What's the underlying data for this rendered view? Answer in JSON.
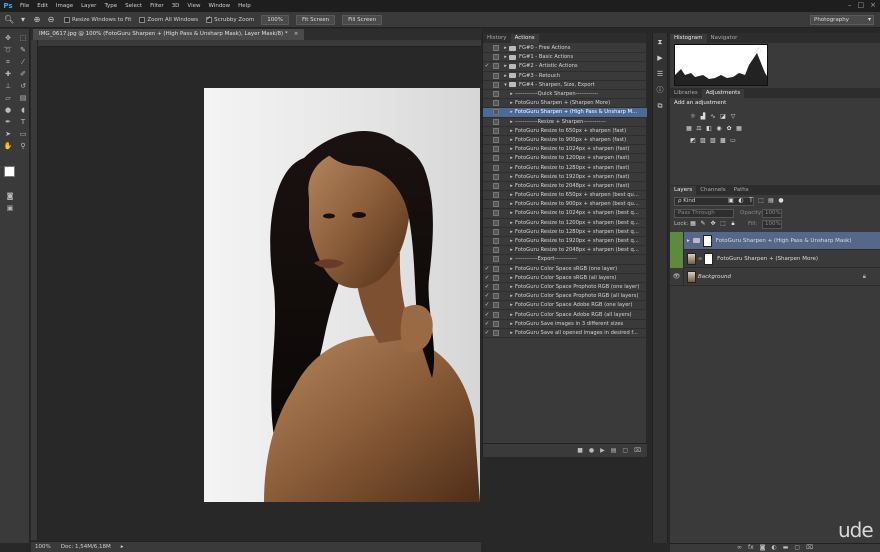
{
  "app": {
    "logo": "Ps"
  },
  "menubar": [
    "File",
    "Edit",
    "Image",
    "Layer",
    "Type",
    "Select",
    "Filter",
    "3D",
    "View",
    "Window",
    "Help"
  ],
  "options": {
    "resize_windows": "Resize Windows to Fit",
    "zoom_all": "Zoom All Windows",
    "scrubby": "Scrubby Zoom",
    "zoom_pct": "100%",
    "fit_screen": "Fit Screen",
    "fill_screen": "Fill Screen",
    "workspace": "Photography"
  },
  "document": {
    "tab_title": "IMG_0617.jpg @ 100% (FotoGuru Sharpen + (High Pass & Unsharp Mask), Layer Mask/8) *"
  },
  "status": {
    "zoom": "100%",
    "doc": "Doc: 1,54M/6,18M"
  },
  "actions_panel": {
    "tabs": [
      "History",
      "Actions"
    ],
    "rows": [
      {
        "label": "FG#0 - Free Actions",
        "type": "folder",
        "check": ""
      },
      {
        "label": "FG#1 - Basic Actions",
        "type": "folder",
        "check": ""
      },
      {
        "label": "FG#2 - Artistic Actions",
        "type": "folder",
        "check": "✓"
      },
      {
        "label": "FG#3 - Retouch",
        "type": "folder",
        "check": ""
      },
      {
        "label": "FG#4 - Sharpen, Size, Export",
        "type": "folder",
        "check": "",
        "open": true
      },
      {
        "label": "------------Quick Sharpen------------",
        "type": "divider",
        "check": ""
      },
      {
        "label": "FotoGuru Sharpen + (Sharpen More)",
        "type": "action",
        "check": ""
      },
      {
        "label": "FotoGuru Sharpen + (High Pass & Unsharp M...",
        "type": "action",
        "check": "",
        "selected": true
      },
      {
        "label": "------------Resize + Sharpen------------",
        "type": "divider",
        "check": ""
      },
      {
        "label": "FotoGuru Resize to 650px + sharpen (fast)",
        "type": "action",
        "check": ""
      },
      {
        "label": "FotoGuru Resize to 900px + sharpen (fast)",
        "type": "action",
        "check": ""
      },
      {
        "label": "FotoGuru Resize to 1024px + sharpen (fast)",
        "type": "action",
        "check": ""
      },
      {
        "label": "FotoGuru Resize to 1200px + sharpen (fast)",
        "type": "action",
        "check": ""
      },
      {
        "label": "FotoGuru Resize to 1280px + sharpen (fast)",
        "type": "action",
        "check": ""
      },
      {
        "label": "FotoGuru Resize to 1920px + sharpen (fast)",
        "type": "action",
        "check": ""
      },
      {
        "label": "FotoGuru Resize to 2048px + sharpen (fast)",
        "type": "action",
        "check": ""
      },
      {
        "label": "FotoGuru Resize to 650px + sharpen (best qu...",
        "type": "action",
        "check": ""
      },
      {
        "label": "FotoGuru Resize to 900px + sharpen (best qu...",
        "type": "action",
        "check": ""
      },
      {
        "label": "FotoGuru Resize to 1024px + sharpen (best q...",
        "type": "action",
        "check": ""
      },
      {
        "label": "FotoGuru Resize to 1200px + sharpen (best q...",
        "type": "action",
        "check": ""
      },
      {
        "label": "FotoGuru Resize to 1280px + sharpen (best q...",
        "type": "action",
        "check": ""
      },
      {
        "label": "FotoGuru Resize to 1920px + sharpen (best q...",
        "type": "action",
        "check": ""
      },
      {
        "label": "FotoGuru Resize to 2048px + sharpen (best q...",
        "type": "action",
        "check": ""
      },
      {
        "label": "------------Export------------",
        "type": "divider",
        "check": ""
      },
      {
        "label": "FotoGuru Color Space sRGB (one layer)",
        "type": "action",
        "check": "✓"
      },
      {
        "label": "FotoGuru Color Space sRGB (all layers)",
        "type": "action",
        "check": "✓"
      },
      {
        "label": "FotoGuru Color Space Prophoto RGB (one layer)",
        "type": "action",
        "check": "✓"
      },
      {
        "label": "FotoGuru Color Space Prophoto RGB (all layers)",
        "type": "action",
        "check": "✓"
      },
      {
        "label": "FotoGuru Color Space Adobe RGB (one layer)",
        "type": "action",
        "check": "✓"
      },
      {
        "label": "FotoGuru Color Space Adobe RGB (all layers)",
        "type": "action",
        "check": "✓"
      },
      {
        "label": "FotoGuru Save images in 3 different sizes",
        "type": "action",
        "check": "✓"
      },
      {
        "label": "FotoGuru Save all opened images in desired f...",
        "type": "action",
        "check": "✓"
      }
    ]
  },
  "histogram": {
    "tabs": [
      "Histogram",
      "Navigator"
    ],
    "warning": "⚠"
  },
  "adjustments": {
    "tabs": [
      "Libraries",
      "Adjustments"
    ],
    "title": "Add an adjustment"
  },
  "layers_panel": {
    "tabs": [
      "Layers",
      "Channels",
      "Paths"
    ],
    "filter": "ρ Kind",
    "blend_mode": "Pass Through",
    "opacity_label": "Opacity:",
    "opacity": "100%",
    "lock_label": "Lock:",
    "fill_label": "Fill:",
    "fill": "100%",
    "layers": [
      {
        "name": "FotoGuru Sharpen + (High Pass & Unsharp Mask)",
        "kind": "group",
        "selected": true
      },
      {
        "name": "FotoGuru Sharpen + (Sharpen More)",
        "kind": "layer",
        "selected": false
      },
      {
        "name": "Background",
        "kind": "background",
        "selected": false
      }
    ]
  },
  "watermark": "ude"
}
